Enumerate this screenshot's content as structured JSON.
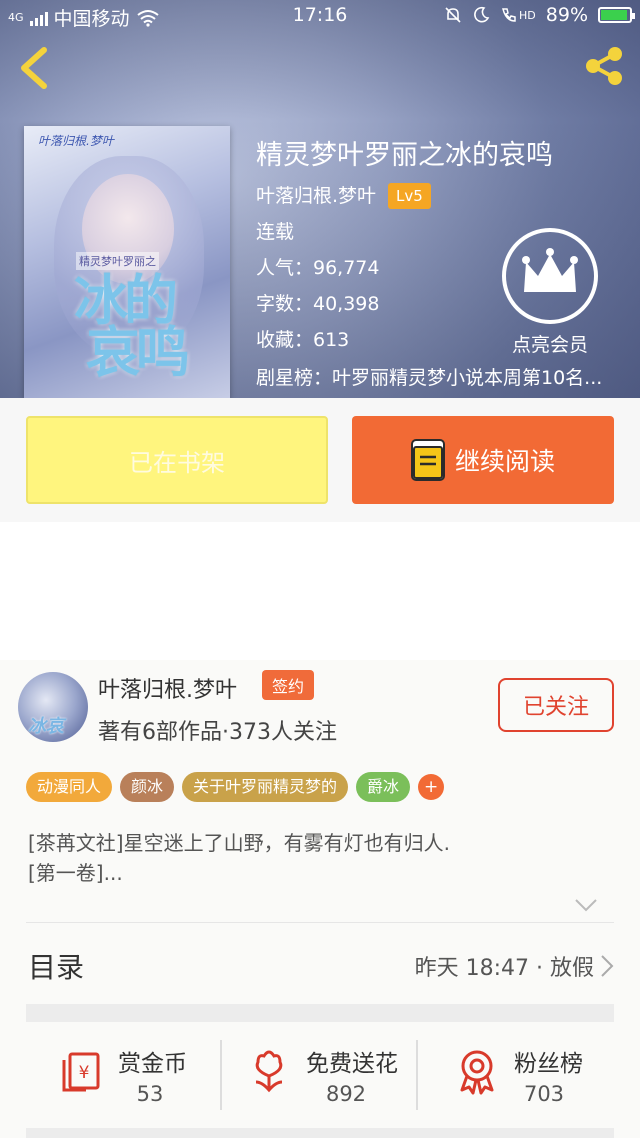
{
  "status_bar": {
    "network_type": "4G",
    "carrier": "中国移动",
    "time": "17:16",
    "hd_label": "HD",
    "battery_percent": "89%"
  },
  "book": {
    "title": "精灵梦叶罗丽之冰的哀鸣",
    "author": "叶落归根.梦叶",
    "author_level": "Lv5",
    "status": "连载",
    "popularity": "人气：96,774",
    "word_count": "字数：40,398",
    "favorites": "收藏：613",
    "ranking": "剧星榜：叶罗丽精灵梦小说本周第10名...",
    "cover_text": {
      "series": "叶落归根.梦叶",
      "subtitle": "精灵梦叶罗丽之",
      "main": "冰的哀鸣"
    }
  },
  "vip": {
    "label": "点亮会员"
  },
  "actions": {
    "shelf_label": "已在书架",
    "read_label": "继续阅读"
  },
  "author_card": {
    "name": "叶落归根.梦叶",
    "badge": "签约",
    "stats": "著有6部作品·373人关注",
    "follow_label": "已关注"
  },
  "tags": [
    {
      "label": "动漫同人",
      "color": "#f2a93b"
    },
    {
      "label": "颜冰",
      "color": "#b9805a"
    },
    {
      "label": "关于叶罗丽精灵梦的",
      "color": "#c9a24a"
    },
    {
      "label": "爵冰",
      "color": "#7bbf5a"
    }
  ],
  "tag_more": "+",
  "description": {
    "line1": "[茶苒文社]星空迷上了山野，有雾有灯也有归人.",
    "line2": "[第一卷]..."
  },
  "toc": {
    "title": "目录",
    "updated": "昨天 18:47 · 放假"
  },
  "stats": [
    {
      "label": "赏金币",
      "value": "53",
      "icon": "reward-coin-icon"
    },
    {
      "label": "免费送花",
      "value": "892",
      "icon": "flower-icon"
    },
    {
      "label": "粉丝榜",
      "value": "703",
      "icon": "fan-rank-medal-icon"
    }
  ],
  "colors": {
    "accent": "#f26a35",
    "follow": "#e0432f",
    "shelf_button": "#fff57e",
    "level_badge": "#f5a623"
  }
}
